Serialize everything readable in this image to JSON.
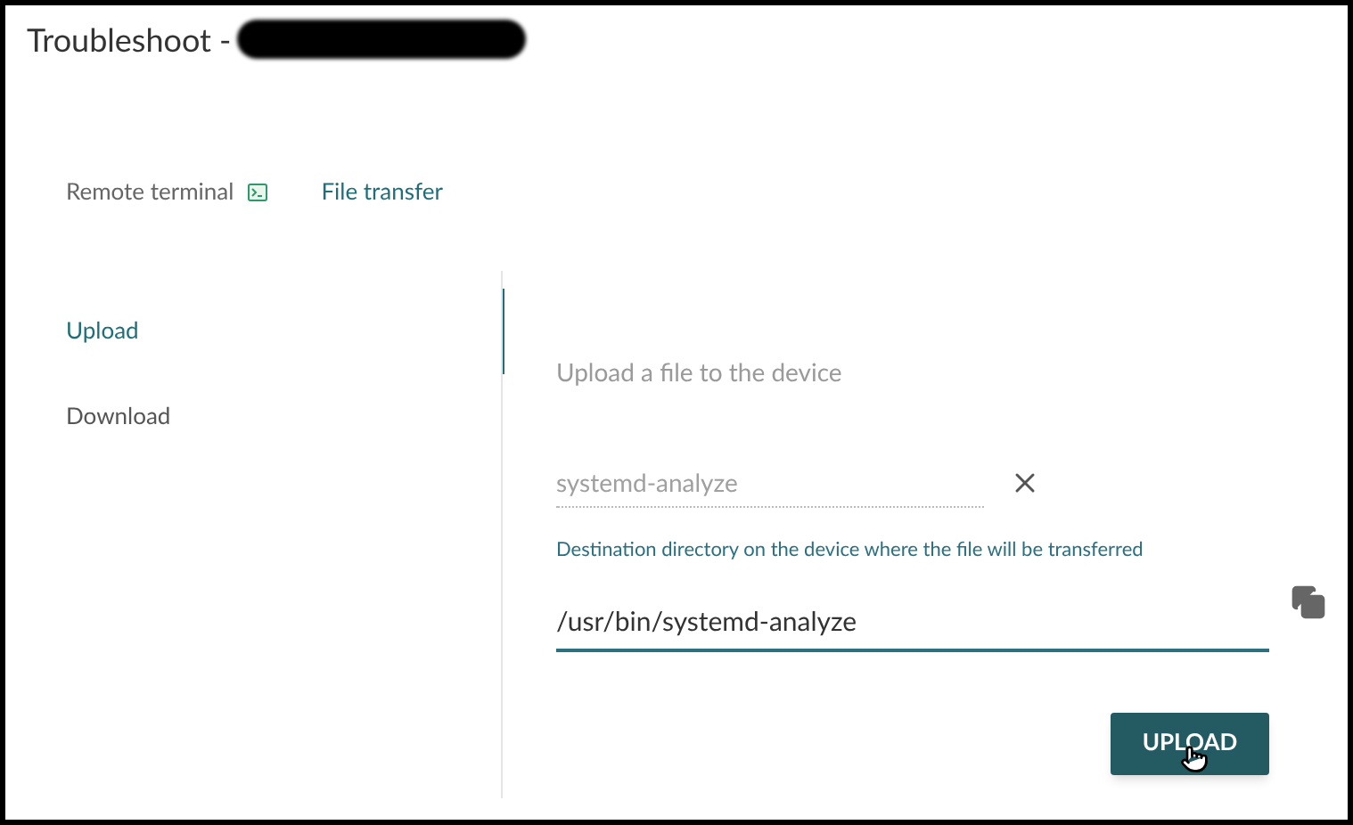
{
  "title": "Troubleshoot -",
  "tabs": [
    {
      "label": "Remote terminal",
      "selected": false,
      "kind": "terminal"
    },
    {
      "label": "File transfer",
      "selected": true
    }
  ],
  "side_tabs": [
    {
      "label": "Upload",
      "selected": true
    },
    {
      "label": "Download",
      "selected": false
    }
  ],
  "panel": {
    "heading": "Upload a file to the device",
    "file_field": {
      "value": "systemd-analyze",
      "disabled": true
    },
    "destination_hint": "Destination directory on the device where the file will be transferred",
    "destination_field": {
      "value": "/usr/bin/systemd-analyze",
      "focused": true
    },
    "button": "UPLOAD"
  }
}
